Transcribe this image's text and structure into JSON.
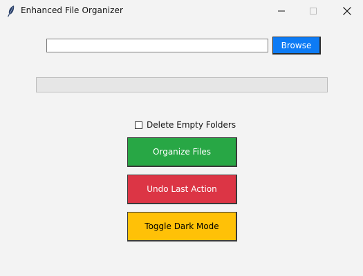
{
  "window": {
    "title": "Enhanced File Organizer",
    "controls": {
      "minimize": "minimize",
      "maximize": "maximize",
      "close": "close"
    }
  },
  "path": {
    "value": "",
    "placeholder": ""
  },
  "browse": {
    "label": "Browse",
    "color": "#0d7bf5"
  },
  "progress": {
    "value_percent": 0
  },
  "options": {
    "delete_empty_folders": {
      "label": "Delete Empty Folders",
      "checked": false
    }
  },
  "actions": {
    "organize": {
      "label": "Organize Files",
      "color": "#28a745"
    },
    "undo": {
      "label": "Undo Last Action",
      "color": "#dc3545"
    },
    "toggle_dark": {
      "label": "Toggle Dark Mode",
      "color": "#ffc107"
    }
  }
}
